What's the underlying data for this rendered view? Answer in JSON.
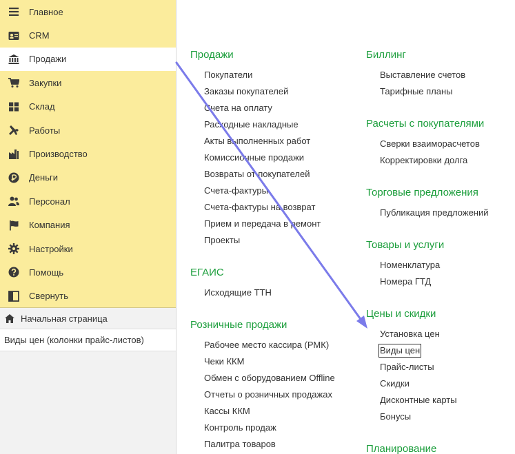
{
  "sidebar": {
    "items": [
      {
        "label": "Главное",
        "icon": "hamburger-menu-icon"
      },
      {
        "label": "CRM",
        "icon": "contact-card-icon"
      },
      {
        "label": "Продажи",
        "icon": "cash-register-icon"
      },
      {
        "label": "Закупки",
        "icon": "shopping-cart-icon"
      },
      {
        "label": "Склад",
        "icon": "warehouse-grid-icon"
      },
      {
        "label": "Работы",
        "icon": "tools-icon"
      },
      {
        "label": "Производство",
        "icon": "factory-icon"
      },
      {
        "label": "Деньги",
        "icon": "ruble-coin-icon"
      },
      {
        "label": "Персонал",
        "icon": "people-icon"
      },
      {
        "label": "Компания",
        "icon": "flag-icon"
      },
      {
        "label": "Настройки",
        "icon": "gear-icon"
      },
      {
        "label": "Помощь",
        "icon": "question-icon"
      },
      {
        "label": "Свернуть",
        "icon": "collapse-panel-icon"
      }
    ],
    "active_index": 2,
    "home_label": "Начальная страница",
    "open_window": "Виды цен (колонки прайс-листов)"
  },
  "menu": {
    "col1": [
      {
        "title": "Продажи",
        "links": [
          "Покупатели",
          "Заказы покупателей",
          "Счета на оплату",
          "Расходные накладные",
          "Акты выполненных работ",
          "Комиссионные продажи",
          "Возвраты от покупателей",
          "Счета-фактуры",
          "Счета-фактуры на возврат",
          "Прием и передача в ремонт",
          "Проекты"
        ]
      },
      {
        "title": "ЕГАИС",
        "links": [
          "Исходящие ТТН"
        ]
      },
      {
        "title": "Розничные продажи",
        "links": [
          "Рабочее место кассира (РМК)",
          "Чеки ККМ",
          "Обмен с оборудованием Offline",
          "Отчеты о розничных продажах",
          "Кассы ККМ",
          "Контроль продаж",
          "Палитра товаров"
        ]
      }
    ],
    "col2": [
      {
        "title": "Биллинг",
        "links": [
          "Выставление счетов",
          "Тарифные планы"
        ]
      },
      {
        "title": "Расчеты с покупателями",
        "links": [
          "Сверки взаиморасчетов",
          "Корректировки долга"
        ]
      },
      {
        "title": "Торговые предложения",
        "links": [
          "Публикация предложений"
        ]
      },
      {
        "title": "Товары и услуги",
        "links": [
          "Номенклатура",
          "Номера ГТД"
        ]
      },
      {
        "title": "Цены и скидки",
        "links": [
          "Установка цен",
          "Виды цен",
          "Прайс-листы",
          "Скидки",
          "Дисконтные карты",
          "Бонусы"
        ]
      },
      {
        "title": "Планирование",
        "links": []
      }
    ]
  },
  "colors": {
    "sidebar_bg": "#fbec9c",
    "section_title": "#1c9e3c",
    "arrow": "#7b7bea",
    "icon": "#3a3a3a"
  }
}
